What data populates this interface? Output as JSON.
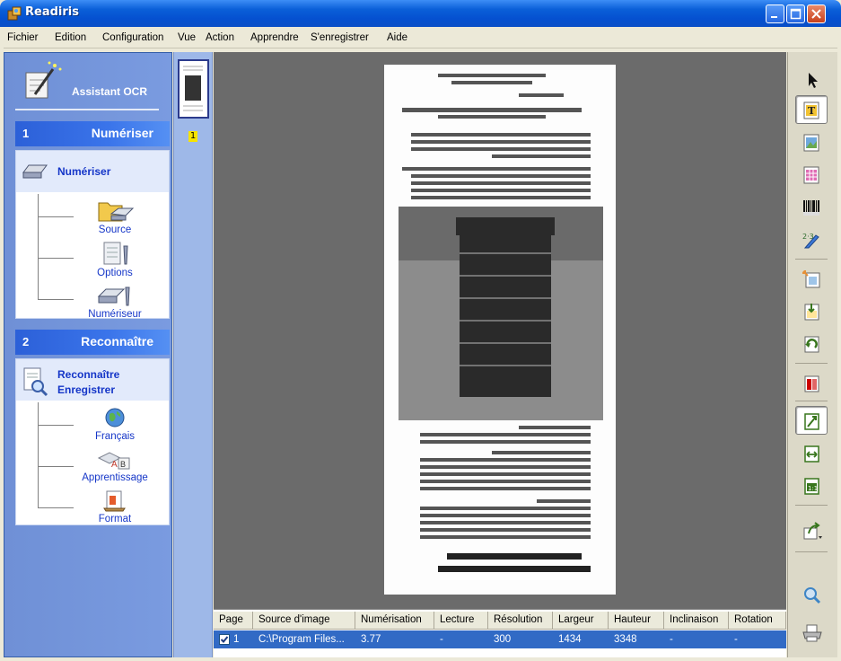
{
  "window": {
    "title": "Readiris"
  },
  "menu": [
    "Fichier",
    "Edition",
    "Configuration",
    "Vue",
    "Action",
    "Apprendre",
    "S'enregistrer",
    "Aide"
  ],
  "assistant": {
    "title": "Assistant OCR",
    "sections": [
      {
        "number": "1",
        "title": "Numériser",
        "band_title": "Numériser",
        "items": [
          {
            "label": "Source",
            "icon": "folder-scanner-icon"
          },
          {
            "label": "Options",
            "icon": "options-icon"
          },
          {
            "label": "Numériseur",
            "icon": "scanner-wrench-icon"
          }
        ]
      },
      {
        "number": "2",
        "title": "Reconnaître",
        "band_title_1": "Reconnaître",
        "band_title_2": "Enregistrer",
        "items": [
          {
            "label": "Français",
            "icon": "globe-icon"
          },
          {
            "label": "Apprentissage",
            "icon": "learning-icon"
          },
          {
            "label": "Format",
            "icon": "format-icon"
          }
        ]
      }
    ]
  },
  "thumbnails": [
    {
      "page_number": "1",
      "selected": true
    }
  ],
  "document_text": {
    "header1": "Detecting the page orientation",
    "header2": "Straightening skewed images",
    "footer_url": "web-site: www.irislink.com",
    "footer_copy": "Copyright I.R.I.S."
  },
  "table": {
    "columns": [
      "Page",
      "Source d'image",
      "Numérisation",
      "Lecture",
      "Résolution",
      "Largeur",
      "Hauteur",
      "Inclinaison",
      "Rotation"
    ],
    "rows": [
      {
        "checked": true,
        "page": "1",
        "source": "C:\\Program Files...",
        "numerisation": "3.77",
        "lecture": "-",
        "resolution": "300",
        "largeur": "1434",
        "hauteur": "3348",
        "inclinaison": "-",
        "rotation": "-"
      }
    ]
  },
  "toolbar_right": [
    "pointer-icon",
    "text-zone-icon",
    "picture-zone-icon",
    "table-zone-icon",
    "barcode-zone-icon",
    "handwriting-zone-icon",
    "auto-analysis-icon",
    "order-zones-icon",
    "rotate-icon",
    "split-icon",
    "fit-page-icon",
    "fit-width-icon",
    "actual-size-icon",
    "export-icon",
    "zoom-icon",
    "print-icon"
  ],
  "colors": {
    "titlebar": "#0a5fd8",
    "selection": "#316ac5",
    "panel": "#7a9be0",
    "section_header": "#3a74ea",
    "link": "#1536c8"
  }
}
